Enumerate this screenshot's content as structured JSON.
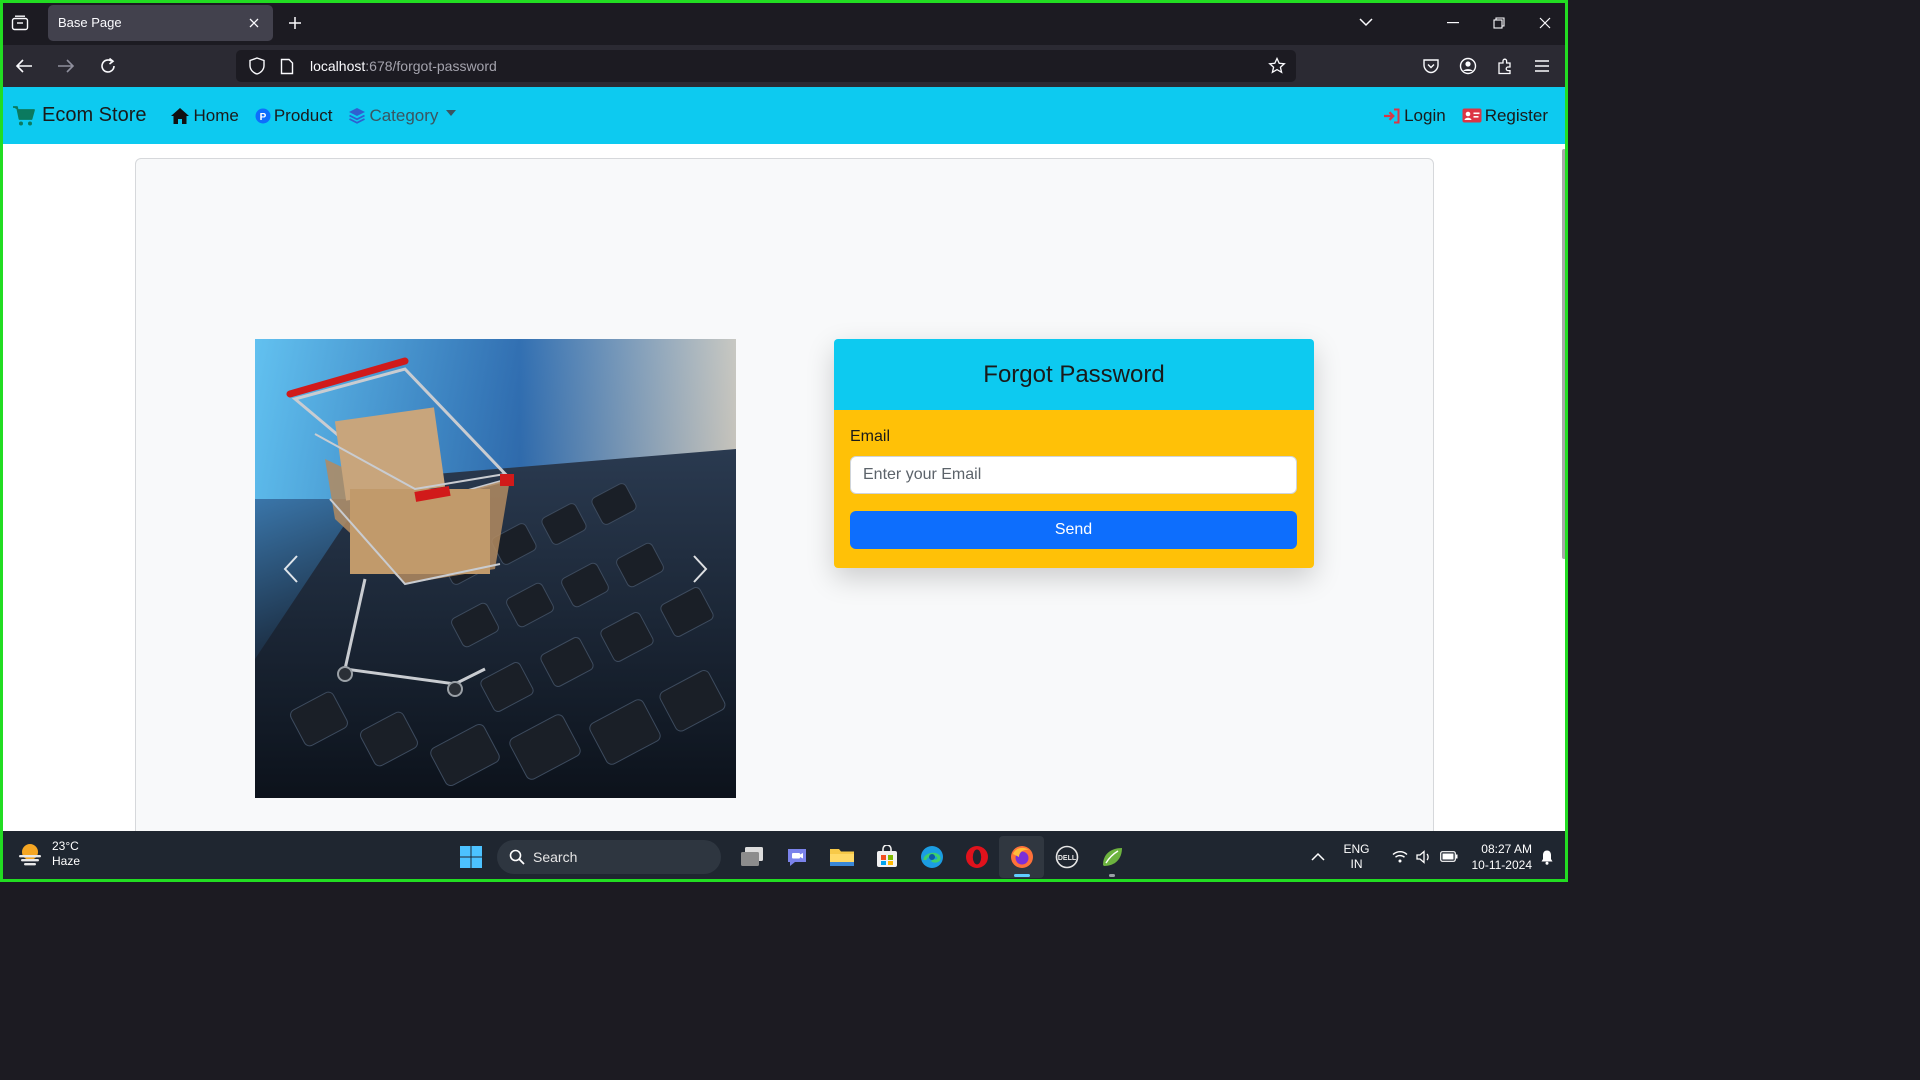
{
  "browser": {
    "tab_title": "Base Page",
    "url_host": "localhost",
    "url_rest": ":678/forgot-password"
  },
  "site": {
    "brand": "Ecom Store",
    "nav_home": "Home",
    "nav_product": "Product",
    "nav_category": "Category",
    "nav_login": "Login",
    "nav_register": "Register"
  },
  "forgot": {
    "title": "Forgot Password",
    "email_label": "Email",
    "email_placeholder": "Enter your Email",
    "send_label": "Send"
  },
  "taskbar": {
    "temperature": "23°C",
    "weather": "Haze",
    "search_label": "Search",
    "lang_1": "ENG",
    "lang_2": "IN",
    "time": "08:27 AM",
    "date": "10-11-2024"
  },
  "colors": {
    "navbar": "#0dcaf0",
    "form_body": "#ffc107",
    "send_button": "#0d6efd"
  }
}
